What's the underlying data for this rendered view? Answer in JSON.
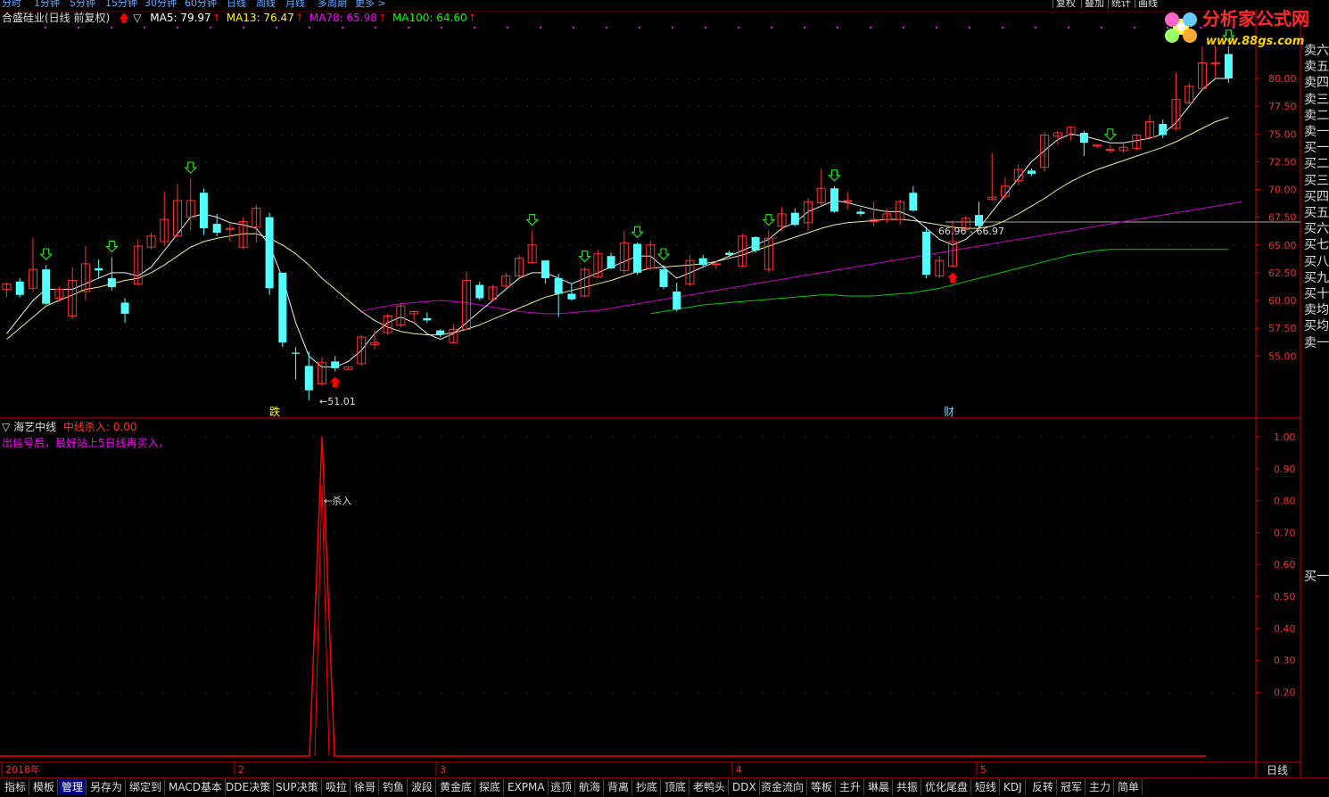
{
  "top_menu": [
    "分时",
    "1分钟",
    "5分钟",
    "15分钟",
    "30分钟",
    "60分钟",
    "日线",
    "周线",
    "月线",
    "多周期",
    "更多 >"
  ],
  "top_right": [
    "复权",
    "叠加",
    "统计",
    "画线"
  ],
  "logo": {
    "text": "分析家公式网",
    "url": "www.88gs.com"
  },
  "header": {
    "stock": "合盛硅业(日线 前复权)",
    "indicators": [
      {
        "label": "MA5: 79.97",
        "color": "#ffffff"
      },
      {
        "label": "MA13: 76.47",
        "color": "#ffff00"
      },
      {
        "label": "MA78: 65.98",
        "color": "#ff00ff"
      },
      {
        "label": "MA100: 64.60",
        "color": "#00ff00"
      }
    ]
  },
  "price_axis": [
    "80.00",
    "77.50",
    "75.00",
    "72.50",
    "70.00",
    "67.50",
    "65.00",
    "62.50",
    "60.00",
    "57.50",
    "55.00"
  ],
  "ind_axis": [
    "1.00",
    "0.90",
    "0.80",
    "0.70",
    "0.60",
    "0.50",
    "0.40",
    "0.30",
    "0.20"
  ],
  "annotations": {
    "low": "51.01",
    "level": "66.96 - 66.97",
    "fall": "跌",
    "cai": "财",
    "kill": "杀入"
  },
  "panel2": {
    "name": "海艺中线",
    "value_label": "中线杀入: 0.00",
    "note": "出信号后，最好站上5日线再买入，"
  },
  "time_axis": [
    "2018年",
    "2",
    "3",
    "4",
    "5"
  ],
  "period_label": "日线",
  "side_list": [
    "卖六",
    "卖五",
    "卖四",
    "卖三",
    "卖二",
    "卖一",
    "买一",
    "买二",
    "买三",
    "买四",
    "买五",
    "买六",
    "买七",
    "买八",
    "买九",
    "买十",
    "卖均",
    "买均",
    "卖一"
  ],
  "side_list_lower": "买一",
  "bottom_tabs": [
    "指标",
    "模板",
    "管理",
    "另存为",
    "绑定到",
    "MACD基本",
    "DDE决策",
    "SUP决策",
    "吸拉",
    "徐哥",
    "钓鱼",
    "波段",
    "黄金底",
    "探底",
    "EXPMA",
    "逃顶",
    "航海",
    "背离",
    "抄底",
    "顶底",
    "老鸭头",
    "DDX",
    "资金流向",
    "等板",
    "主升",
    "琳晨",
    "共振",
    "优化尾盘",
    "短线",
    "KDJ",
    "反转",
    "冠军",
    "主力",
    "简单"
  ],
  "active_tab": "管理",
  "chart_data": {
    "type": "candlestick",
    "candles": [
      [
        61.0,
        61.5,
        60.3,
        61.6
      ],
      [
        61.7,
        60.5,
        60.3,
        62.0
      ],
      [
        61.1,
        62.8,
        60.8,
        65.6
      ],
      [
        62.8,
        59.7,
        59.6,
        63.2
      ],
      [
        60.2,
        61.0,
        59.9,
        61.2
      ],
      [
        58.6,
        61.8,
        58.3,
        63.0
      ],
      [
        60.8,
        63.3,
        60.0,
        64.9
      ],
      [
        62.9,
        62.7,
        62.0,
        63.7
      ],
      [
        62.0,
        61.2,
        60.9,
        63.9
      ],
      [
        59.8,
        58.8,
        58.0,
        60.2
      ],
      [
        61.5,
        64.9,
        61.3,
        65.5
      ],
      [
        64.8,
        65.8,
        64.6,
        66.1
      ],
      [
        65.3,
        67.3,
        64.9,
        69.8
      ],
      [
        65.8,
        69.0,
        65.7,
        70.5
      ],
      [
        67.5,
        69.0,
        66.3,
        71.0
      ],
      [
        69.7,
        66.5,
        65.9,
        70.1
      ],
      [
        66.9,
        66.1,
        65.8,
        67.8
      ],
      [
        66.4,
        66.5,
        65.3,
        67.0
      ],
      [
        64.8,
        67.1,
        64.6,
        67.5
      ],
      [
        66.6,
        68.3,
        65.2,
        68.6
      ],
      [
        67.5,
        61.1,
        60.5,
        67.9
      ],
      [
        62.5,
        56.2,
        55.8,
        62.5
      ],
      [
        55.3,
        55.2,
        52.9,
        55.8
      ],
      [
        54.1,
        51.9,
        51.01,
        55.4
      ],
      [
        52.5,
        54.4,
        52.3,
        54.9
      ],
      [
        54.5,
        53.9,
        53.6,
        55.0
      ],
      [
        53.8,
        54.0,
        53.8,
        54.0
      ],
      [
        54.3,
        56.7,
        54.1,
        56.9
      ],
      [
        56.0,
        56.2,
        55.6,
        57.3
      ],
      [
        57.1,
        58.6,
        56.9,
        58.8
      ],
      [
        57.8,
        59.5,
        57.6,
        59.8
      ],
      [
        58.8,
        59.0,
        58.0,
        59.1
      ],
      [
        58.4,
        58.2,
        58.0,
        58.9
      ],
      [
        57.3,
        56.9,
        56.7,
        57.4
      ],
      [
        56.2,
        57.4,
        56.1,
        57.9
      ],
      [
        57.4,
        61.8,
        57.3,
        62.6
      ],
      [
        61.4,
        60.2,
        60.0,
        61.7
      ],
      [
        60.1,
        61.2,
        60.0,
        61.4
      ],
      [
        61.3,
        62.2,
        61.1,
        62.5
      ],
      [
        62.2,
        63.8,
        62.0,
        64.1
      ],
      [
        63.4,
        65.0,
        63.3,
        66.3
      ],
      [
        63.6,
        62.0,
        61.5,
        63.6
      ],
      [
        62.0,
        60.6,
        58.5,
        62.4
      ],
      [
        60.6,
        60.1,
        60.0,
        61.5
      ],
      [
        60.4,
        62.8,
        60.3,
        63.0
      ],
      [
        62.1,
        64.2,
        62.0,
        64.6
      ],
      [
        64.0,
        62.9,
        62.8,
        64.3
      ],
      [
        62.7,
        65.2,
        62.4,
        66.3
      ],
      [
        65.1,
        62.5,
        62.3,
        65.2
      ],
      [
        62.9,
        65.0,
        62.7,
        65.4
      ],
      [
        62.8,
        61.2,
        61.0,
        63.2
      ],
      [
        60.8,
        59.2,
        59.0,
        61.6
      ],
      [
        61.5,
        63.6,
        61.3,
        64.1
      ],
      [
        63.8,
        63.2,
        63.0,
        64.1
      ],
      [
        63.3,
        63.3,
        62.8,
        63.6
      ],
      [
        64.3,
        64.1,
        63.9,
        64.5
      ],
      [
        63.1,
        65.8,
        63.0,
        66.0
      ],
      [
        65.7,
        64.5,
        64.3,
        65.8
      ],
      [
        62.8,
        65.6,
        62.5,
        66.3
      ],
      [
        66.7,
        67.8,
        66.3,
        68.4
      ],
      [
        67.9,
        66.8,
        66.7,
        68.3
      ],
      [
        67.0,
        68.9,
        66.3,
        69.2
      ],
      [
        68.8,
        70.1,
        68.6,
        71.9
      ],
      [
        70.1,
        68.0,
        67.9,
        70.3
      ],
      [
        69.0,
        69.0,
        68.2,
        69.8
      ],
      [
        68.0,
        67.8,
        67.6,
        68.3
      ],
      [
        67.1,
        67.3,
        66.7,
        68.9
      ],
      [
        67.3,
        67.8,
        67.0,
        68.2
      ],
      [
        67.3,
        68.9,
        66.8,
        69.1
      ],
      [
        69.7,
        68.1,
        68.0,
        70.3
      ],
      [
        66.2,
        62.3,
        62.0,
        66.6
      ],
      [
        62.2,
        63.6,
        62.0,
        64.0
      ],
      [
        63.1,
        65.3,
        63.0,
        67.2
      ],
      [
        66.4,
        67.4,
        66.2,
        67.6
      ],
      [
        67.7,
        66.7,
        66.5,
        68.9
      ],
      [
        69.1,
        69.3,
        69.0,
        73.3
      ],
      [
        69.4,
        70.3,
        69.1,
        71.1
      ],
      [
        70.8,
        71.8,
        70.4,
        72.3
      ],
      [
        71.7,
        71.4,
        71.2,
        71.9
      ],
      [
        72.0,
        74.9,
        71.6,
        75.2
      ],
      [
        74.8,
        75.1,
        74.0,
        75.3
      ],
      [
        74.9,
        75.6,
        74.4,
        75.7
      ],
      [
        75.1,
        74.2,
        73.0,
        75.3
      ],
      [
        73.9,
        74.0,
        73.7,
        74.1
      ],
      [
        73.6,
        73.6,
        73.3,
        74.0
      ],
      [
        73.5,
        73.8,
        73.3,
        74.1
      ],
      [
        73.7,
        74.9,
        73.5,
        75.0
      ],
      [
        74.7,
        76.1,
        74.6,
        76.7
      ],
      [
        75.9,
        74.9,
        74.6,
        76.3
      ],
      [
        75.5,
        78.1,
        75.3,
        80.5
      ],
      [
        77.8,
        79.3,
        77.7,
        79.6
      ],
      [
        79.1,
        81.4,
        79.0,
        82.9
      ],
      [
        81.3,
        81.4,
        80.0,
        83.0
      ],
      [
        82.2,
        80.0,
        79.6,
        82.9
      ]
    ],
    "ma5": [
      57.0,
      58.5,
      60.0,
      61.0,
      61.0,
      61.0,
      61.5,
      62.0,
      62.5,
      62.5,
      62.2,
      63.0,
      64.5,
      66.0,
      67.5,
      67.8,
      67.5,
      67.0,
      66.8,
      66.5,
      65.0,
      62.0,
      58.0,
      55.0,
      54.0,
      54.0,
      54.5,
      55.5,
      57.0,
      58.0,
      58.5,
      58.0,
      57.0,
      56.5,
      57.0,
      58.0,
      59.0,
      60.0,
      61.0,
      62.0,
      62.5,
      62.5,
      62.0,
      61.5,
      62.0,
      62.5,
      63.0,
      63.5,
      64.0,
      64.0,
      63.0,
      62.0,
      62.5,
      63.0,
      63.5,
      64.0,
      64.5,
      65.0,
      65.5,
      66.5,
      67.0,
      68.0,
      68.5,
      69.0,
      68.8,
      68.5,
      68.2,
      68.0,
      68.0,
      67.5,
      66.5,
      65.5,
      65.0,
      65.5,
      66.5,
      68.0,
      69.5,
      71.0,
      72.5,
      73.5,
      74.5,
      75.0,
      74.8,
      74.5,
      74.2,
      74.2,
      74.4,
      74.6,
      75.0,
      76.0,
      77.5,
      79.0,
      80.0,
      80.0
    ],
    "ma13": [
      56.5,
      57.5,
      58.5,
      59.5,
      60.0,
      60.5,
      61.0,
      61.2,
      61.5,
      61.8,
      62.0,
      62.5,
      63.2,
      64.0,
      64.8,
      65.3,
      65.6,
      65.8,
      66.0,
      66.0,
      65.6,
      65.0,
      64.2,
      63.2,
      62.0,
      61.0,
      60.0,
      59.0,
      58.2,
      57.6,
      57.2,
      57.0,
      56.9,
      56.9,
      57.1,
      57.4,
      57.8,
      58.3,
      58.8,
      59.3,
      59.8,
      60.3,
      60.6,
      60.9,
      61.2,
      61.5,
      61.8,
      62.2,
      62.6,
      62.9,
      63.0,
      63.1,
      63.2,
      63.3,
      63.5,
      63.8,
      64.1,
      64.5,
      64.9,
      65.3,
      65.7,
      66.1,
      66.5,
      66.8,
      67.0,
      67.1,
      67.2,
      67.3,
      67.3,
      67.2,
      67.0,
      66.8,
      66.6,
      66.5,
      66.5,
      66.7,
      67.2,
      67.8,
      68.5,
      69.2,
      70.0,
      70.7,
      71.3,
      71.8,
      72.2,
      72.6,
      73.0,
      73.4,
      73.8,
      74.3,
      74.9,
      75.5,
      76.1,
      76.5
    ],
    "ma78_from": 27,
    "ma78": [
      59.0,
      59.3,
      59.5,
      59.7,
      59.8,
      59.9,
      60.0,
      59.9,
      59.8,
      59.6,
      59.4,
      59.2,
      59.0,
      58.9,
      58.8,
      58.8,
      58.9,
      59.0,
      59.1,
      59.3,
      59.5,
      59.7,
      59.9,
      60.1,
      60.3,
      60.5,
      60.7,
      60.9,
      61.1,
      61.3,
      61.5,
      61.7,
      61.9,
      62.1,
      62.3,
      62.5,
      62.7,
      62.9,
      63.1,
      63.3,
      63.5,
      63.7,
      63.9,
      64.1,
      64.3,
      64.5,
      64.7,
      64.9,
      65.1,
      65.3,
      65.5,
      65.7,
      65.9,
      66.1,
      66.3,
      66.5,
      66.7,
      66.9,
      67.1,
      67.3,
      67.5,
      67.7,
      67.9,
      68.1,
      68.3,
      68.5,
      68.7,
      68.9
    ],
    "ma100_from": 49,
    "ma100": [
      58.8,
      59.0,
      59.2,
      59.4,
      59.6,
      59.7,
      59.8,
      59.9,
      60.0,
      60.1,
      60.2,
      60.3,
      60.4,
      60.5,
      60.5,
      60.4,
      60.4,
      60.4,
      60.5,
      60.6,
      60.7,
      60.9,
      61.1,
      61.4,
      61.7,
      62.0,
      62.3,
      62.6,
      62.9,
      63.2,
      63.5,
      63.8,
      64.1,
      64.3,
      64.5,
      64.6,
      64.6,
      64.6,
      64.6,
      64.6,
      64.6,
      64.6,
      64.6,
      64.6,
      64.6
    ],
    "down_arrows": [
      3,
      8,
      14,
      40,
      44,
      48,
      50,
      58,
      63,
      84,
      93
    ],
    "up_arrows": [
      25,
      72
    ],
    "indicator_peak_index": 24,
    "ylim": [
      51.0,
      84.0
    ]
  }
}
